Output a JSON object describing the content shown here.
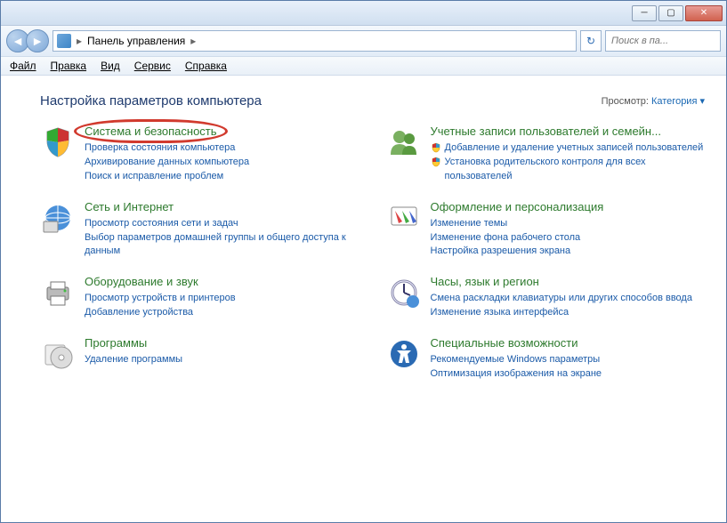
{
  "window": {
    "breadcrumb_root": "Панель управления",
    "breadcrumb_sep": "▸",
    "search_placeholder": "Поиск в па..."
  },
  "menu": {
    "file": "Файл",
    "edit": "Правка",
    "view": "Вид",
    "tools": "Сервис",
    "help": "Справка"
  },
  "header": {
    "title": "Настройка параметров компьютера",
    "view_label": "Просмотр:",
    "view_value": "Категория ▾"
  },
  "left": [
    {
      "title": "Система и безопасность",
      "highlighted": true,
      "links": [
        {
          "text": "Проверка состояния компьютера"
        },
        {
          "text": "Архивирование данных компьютера"
        },
        {
          "text": "Поиск и исправление проблем"
        }
      ]
    },
    {
      "title": "Сеть и Интернет",
      "links": [
        {
          "text": "Просмотр состояния сети и задач"
        },
        {
          "text": "Выбор параметров домашней группы и общего доступа к данным"
        }
      ]
    },
    {
      "title": "Оборудование и звук",
      "links": [
        {
          "text": "Просмотр устройств и принтеров"
        },
        {
          "text": "Добавление устройства"
        }
      ]
    },
    {
      "title": "Программы",
      "links": [
        {
          "text": "Удаление программы"
        }
      ]
    }
  ],
  "right": [
    {
      "title": "Учетные записи пользователей и семейн...",
      "links": [
        {
          "text": "Добавление и удаление учетных записей пользователей",
          "shield": true
        },
        {
          "text": "Установка родительского контроля для всех пользователей",
          "shield": true
        }
      ]
    },
    {
      "title": "Оформление и персонализация",
      "links": [
        {
          "text": "Изменение темы"
        },
        {
          "text": "Изменение фона рабочего стола"
        },
        {
          "text": "Настройка разрешения экрана"
        }
      ]
    },
    {
      "title": "Часы, язык и регион",
      "links": [
        {
          "text": "Смена раскладки клавиатуры или других способов ввода"
        },
        {
          "text": "Изменение языка интерфейса"
        }
      ]
    },
    {
      "title": "Специальные возможности",
      "links": [
        {
          "text": "Рекомендуемые Windows параметры"
        },
        {
          "text": "Оптимизация изображения на экране"
        }
      ]
    }
  ],
  "icons": {
    "left": [
      "shield-security-icon",
      "network-globe-icon",
      "hardware-printer-icon",
      "programs-cd-icon"
    ],
    "right": [
      "user-accounts-icon",
      "personalization-icon",
      "clock-region-icon",
      "accessibility-icon"
    ]
  }
}
